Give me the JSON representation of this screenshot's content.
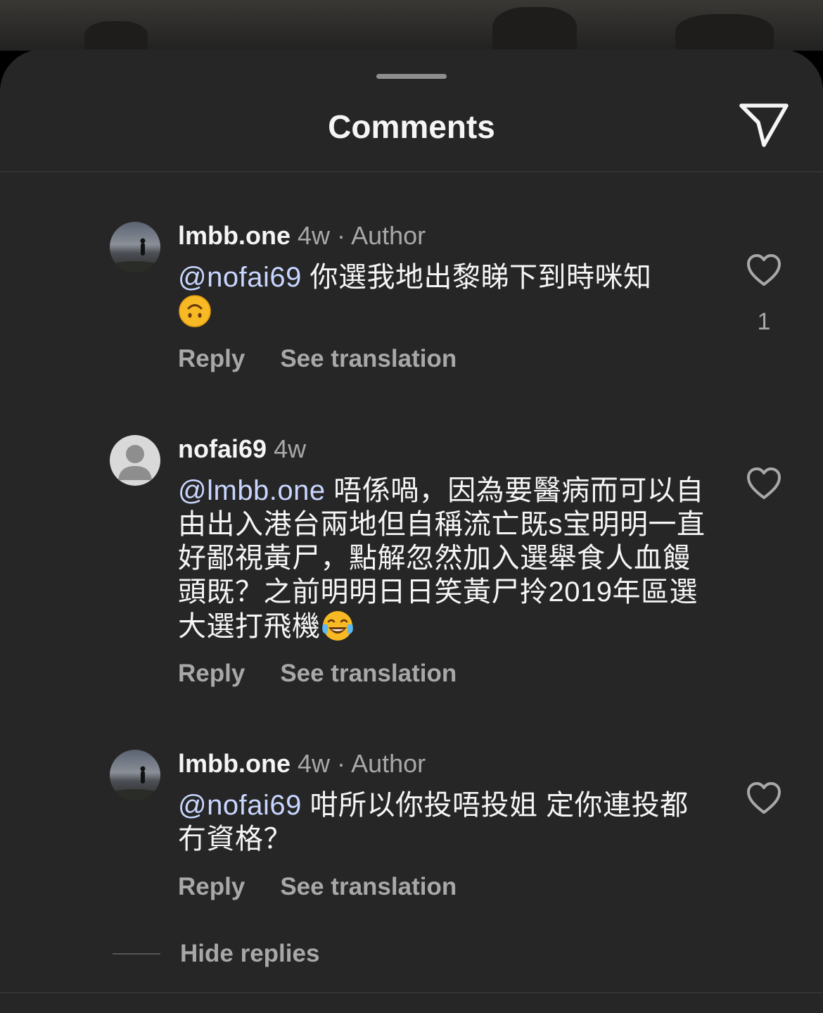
{
  "sheet": {
    "title": "Comments",
    "share_icon": "paper-plane-icon"
  },
  "comments": [
    {
      "username": "lmbb.one",
      "time": "4w",
      "separator": " · ",
      "badge": "Author",
      "mention": "@nofai69",
      "text": " 你選我地出黎睇下到時咪知",
      "emoji": "upside-down-face",
      "likes": "1",
      "reply_label": "Reply",
      "translate_label": "See translation"
    },
    {
      "username": "nofai69",
      "time": "4w",
      "mention": "@lmbb.one",
      "text": " 唔係喎，因為要醫病而可以自由出入港台兩地但自稱流亡既s宝明明一直好鄙視黃尸，點解忽然加入選舉食人血饅頭既？之前明明日日笑黃尸拎2019年區選大選打飛機",
      "emoji": "face-with-tears-of-joy",
      "reply_label": "Reply",
      "translate_label": "See translation"
    },
    {
      "username": "lmbb.one",
      "time": "4w",
      "separator": " · ",
      "badge": "Author",
      "mention": "@nofai69",
      "text": " 咁所以你投唔投姐 定你連投都冇資格？",
      "reply_label": "Reply",
      "translate_label": "See translation"
    }
  ],
  "hide_replies_label": "Hide replies",
  "colors": {
    "sheet_bg": "#262626",
    "text_primary": "#f5f5f5",
    "text_secondary": "#a8a8a8",
    "mention": "#c8d6ff"
  }
}
